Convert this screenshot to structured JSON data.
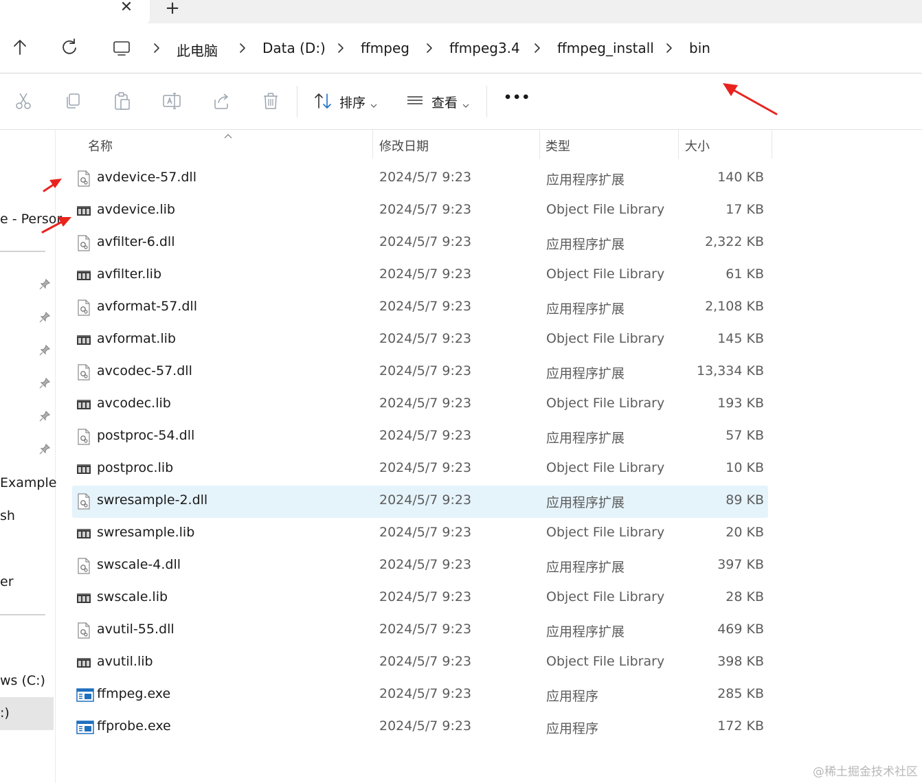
{
  "window": {
    "tab_new_label": "+",
    "tab_close_label": "✕"
  },
  "breadcrumb": [
    "此电脑",
    "Data (D:)",
    "ffmpeg",
    "ffmpeg3.4",
    "ffmpeg_install",
    "bin"
  ],
  "toolbar": {
    "sort_label": "排序",
    "view_label": "查看",
    "more_label": "•••",
    "icons": [
      "cut-icon",
      "copy-icon",
      "paste-icon",
      "rename-icon",
      "share-icon",
      "delete-icon"
    ]
  },
  "sidebar": {
    "items": [
      {
        "label": "e - Persor",
        "pinned": false
      },
      {
        "label": "Example",
        "pinned": false
      },
      {
        "label": "sh",
        "pinned": false
      },
      {
        "label": "er",
        "pinned": false
      },
      {
        "label": "ws (C:)",
        "pinned": false
      },
      {
        "label": ":)",
        "pinned": false,
        "selected": true
      }
    ]
  },
  "columns": {
    "name": "名称",
    "date": "修改日期",
    "type": "类型",
    "size": "大小"
  },
  "files": [
    {
      "name": "avdevice-57.dll",
      "date": "2024/5/7 9:23",
      "type": "应用程序扩展",
      "size": "140 KB",
      "icon": "dll"
    },
    {
      "name": "avdevice.lib",
      "date": "2024/5/7 9:23",
      "type": "Object File Library",
      "size": "17 KB",
      "icon": "lib"
    },
    {
      "name": "avfilter-6.dll",
      "date": "2024/5/7 9:23",
      "type": "应用程序扩展",
      "size": "2,322 KB",
      "icon": "dll"
    },
    {
      "name": "avfilter.lib",
      "date": "2024/5/7 9:23",
      "type": "Object File Library",
      "size": "61 KB",
      "icon": "lib"
    },
    {
      "name": "avformat-57.dll",
      "date": "2024/5/7 9:23",
      "type": "应用程序扩展",
      "size": "2,108 KB",
      "icon": "dll"
    },
    {
      "name": "avformat.lib",
      "date": "2024/5/7 9:23",
      "type": "Object File Library",
      "size": "145 KB",
      "icon": "lib"
    },
    {
      "name": "avcodec-57.dll",
      "date": "2024/5/7 9:23",
      "type": "应用程序扩展",
      "size": "13,334 KB",
      "icon": "dll"
    },
    {
      "name": "avcodec.lib",
      "date": "2024/5/7 9:23",
      "type": "Object File Library",
      "size": "193 KB",
      "icon": "lib"
    },
    {
      "name": "postproc-54.dll",
      "date": "2024/5/7 9:23",
      "type": "应用程序扩展",
      "size": "57 KB",
      "icon": "dll"
    },
    {
      "name": "postproc.lib",
      "date": "2024/5/7 9:23",
      "type": "Object File Library",
      "size": "10 KB",
      "icon": "lib"
    },
    {
      "name": "swresample-2.dll",
      "date": "2024/5/7 9:23",
      "type": "应用程序扩展",
      "size": "89 KB",
      "icon": "dll",
      "selected": true
    },
    {
      "name": "swresample.lib",
      "date": "2024/5/7 9:23",
      "type": "Object File Library",
      "size": "20 KB",
      "icon": "lib"
    },
    {
      "name": "swscale-4.dll",
      "date": "2024/5/7 9:23",
      "type": "应用程序扩展",
      "size": "397 KB",
      "icon": "dll"
    },
    {
      "name": "swscale.lib",
      "date": "2024/5/7 9:23",
      "type": "Object File Library",
      "size": "28 KB",
      "icon": "lib"
    },
    {
      "name": "avutil-55.dll",
      "date": "2024/5/7 9:23",
      "type": "应用程序扩展",
      "size": "469 KB",
      "icon": "dll"
    },
    {
      "name": "avutil.lib",
      "date": "2024/5/7 9:23",
      "type": "Object File Library",
      "size": "398 KB",
      "icon": "lib"
    },
    {
      "name": "ffmpeg.exe",
      "date": "2024/5/7 9:23",
      "type": "应用程序",
      "size": "285 KB",
      "icon": "exe"
    },
    {
      "name": "ffprobe.exe",
      "date": "2024/5/7 9:23",
      "type": "应用程序",
      "size": "172 KB",
      "icon": "exe"
    }
  ],
  "colors": {
    "selection": "#e5f3fb",
    "annotation_arrow": "#e8231e"
  },
  "watermark": "@稀土掘金技术社区"
}
